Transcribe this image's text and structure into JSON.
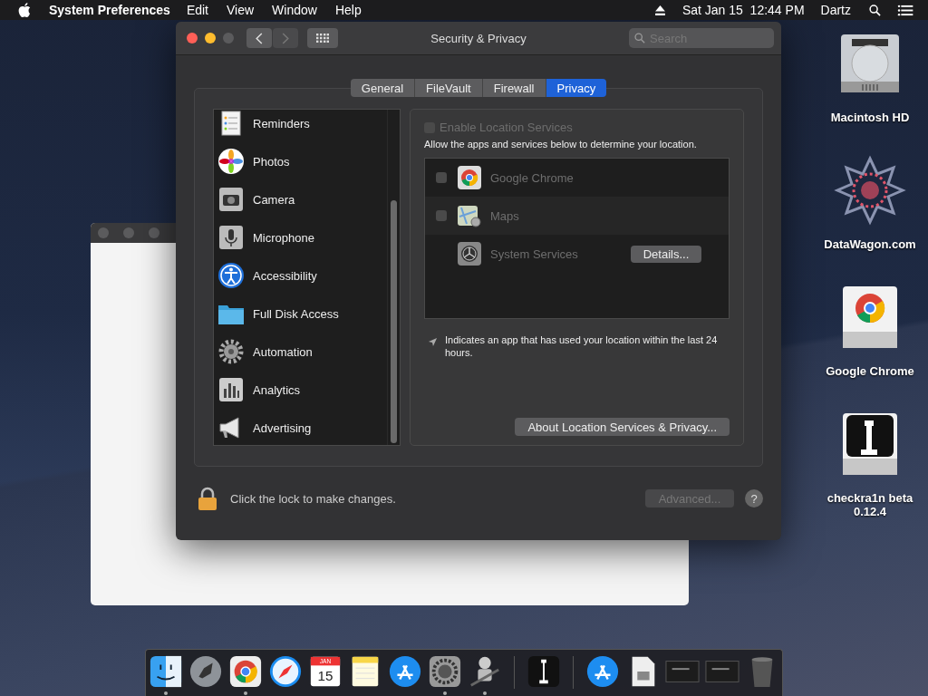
{
  "menu_bar": {
    "app_name": "System Preferences",
    "menus": [
      "Edit",
      "View",
      "Window",
      "Help"
    ],
    "clock": "Sat Jan 15  12:44 PM",
    "user": "Dartz"
  },
  "window": {
    "title": "Security & Privacy",
    "search": {
      "placeholder": "Search"
    },
    "tabs": [
      {
        "label": "General",
        "selected": false
      },
      {
        "label": "FileVault",
        "selected": false
      },
      {
        "label": "Firewall",
        "selected": false
      },
      {
        "label": "Privacy",
        "selected": true
      }
    ],
    "sidebar": {
      "items": [
        {
          "label": "Reminders",
          "selected": false
        },
        {
          "label": "Photos",
          "selected": false
        },
        {
          "label": "Camera",
          "selected": false
        },
        {
          "label": "Microphone",
          "selected": false
        },
        {
          "label": "Accessibility",
          "selected": false
        },
        {
          "label": "Full Disk Access",
          "selected": false
        },
        {
          "label": "Automation",
          "selected": false
        },
        {
          "label": "Analytics",
          "selected": false
        },
        {
          "label": "Advertising",
          "selected": false
        }
      ]
    },
    "location": {
      "enable_checkbox": {
        "label": "Enable Location Services",
        "checked": false,
        "disabled": true
      },
      "description": "Allow the apps and services below to determine your location.",
      "apps": [
        {
          "kind": "checkbox",
          "name": "Google Chrome",
          "checked": false
        },
        {
          "kind": "checkbox",
          "name": "Maps",
          "checked": false
        },
        {
          "kind": "button",
          "name": "System Services",
          "button": "Details..."
        }
      ],
      "note": "Indicates an app that has used your location within the last 24 hours.",
      "about_button": "About Location Services & Privacy..."
    },
    "footer": {
      "lock_text": "Click the lock to make changes.",
      "advanced_button": {
        "label": "Advanced...",
        "disabled": true
      },
      "help_button": "?"
    }
  },
  "desktop_icons": [
    {
      "label": "Macintosh HD"
    },
    {
      "label": "DataWagon.com"
    },
    {
      "label": "Google Chrome"
    },
    {
      "label": "checkra1n beta 0.12.4"
    }
  ],
  "dock": {
    "items": [
      {
        "running": true
      },
      {
        "running": false
      },
      {
        "running": true
      },
      {
        "running": false
      },
      {
        "running": false,
        "month": "JAN",
        "day": "15"
      },
      {
        "running": false
      },
      {
        "running": false
      },
      {
        "running": true
      },
      {
        "running": true
      },
      {
        "running": false
      },
      {
        "running": false
      },
      {
        "running": false
      },
      {
        "running": false
      },
      {
        "running": false
      },
      {
        "running": false
      }
    ]
  }
}
